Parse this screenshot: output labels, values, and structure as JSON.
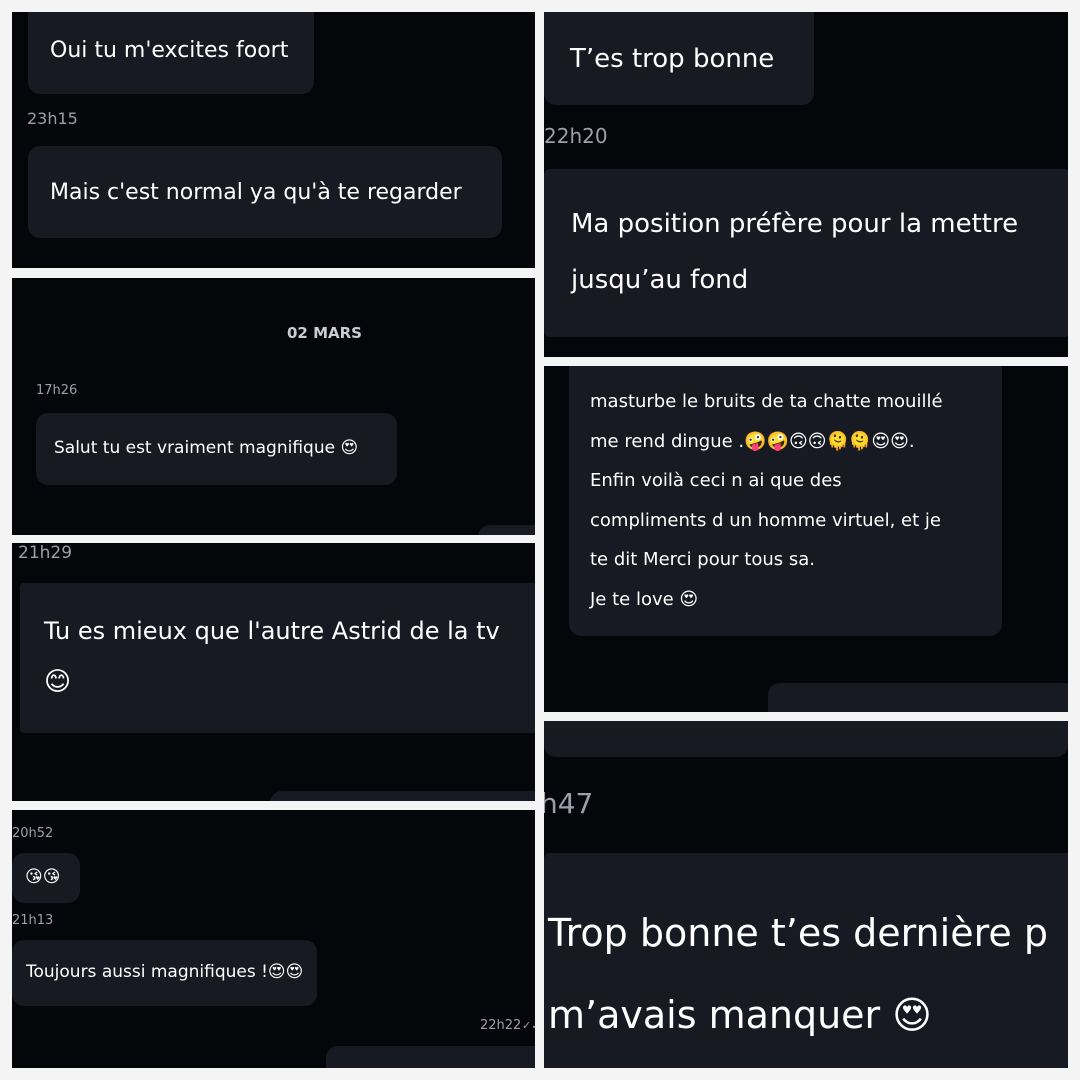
{
  "panels": {
    "p1": {
      "bubble1": "Oui tu m'excites foort",
      "time1": "23h15",
      "bubble2": "Mais c'est normal ya qu'à te regarder"
    },
    "p2": {
      "date_divider": "02 MARS",
      "time1": "17h26",
      "bubble1": "Salut tu est vraiment magnifique 😍"
    },
    "p3": {
      "time1": "21h29",
      "bubble1_line1": "Tu es mieux que l'autre Astrid de la tv",
      "bubble1_line2": "😊"
    },
    "p4": {
      "time1": "20h52",
      "bubble1": "😘😘",
      "time2": "21h13",
      "bubble2": "Toujours aussi magnifiques !😍😍",
      "time3": "22h22"
    },
    "p5": {
      "bubble1": "T’es trop bonne",
      "time1": "22h20",
      "bubble2_line1": "Ma position préfère pour la mettre",
      "bubble2_line2": "jusqu’au fond"
    },
    "p6": {
      "lines": [
        "masturbe le bruits de ta chatte mouillé",
        "me rend dingue .🤪🤪🙃🙃🫠🫠😍😍.",
        "Enfin voilà ceci n ai que des",
        "compliments d un homme virtuel, et je",
        "te dit Merci pour tous sa.",
        "Je te love 😍"
      ]
    },
    "p7": {
      "time1": "h47",
      "bubble1_line1": "Trop bonne t’es dernière p",
      "bubble1_line2": "m’avais manquer 😍"
    }
  },
  "icons": {
    "read_receipt": "double-check-icon"
  },
  "colors": {
    "panel_bg": "#05060a",
    "bubble_bg": "#171a22",
    "timestamp": "#9aa0aa",
    "frame": "#f4f4f4"
  }
}
